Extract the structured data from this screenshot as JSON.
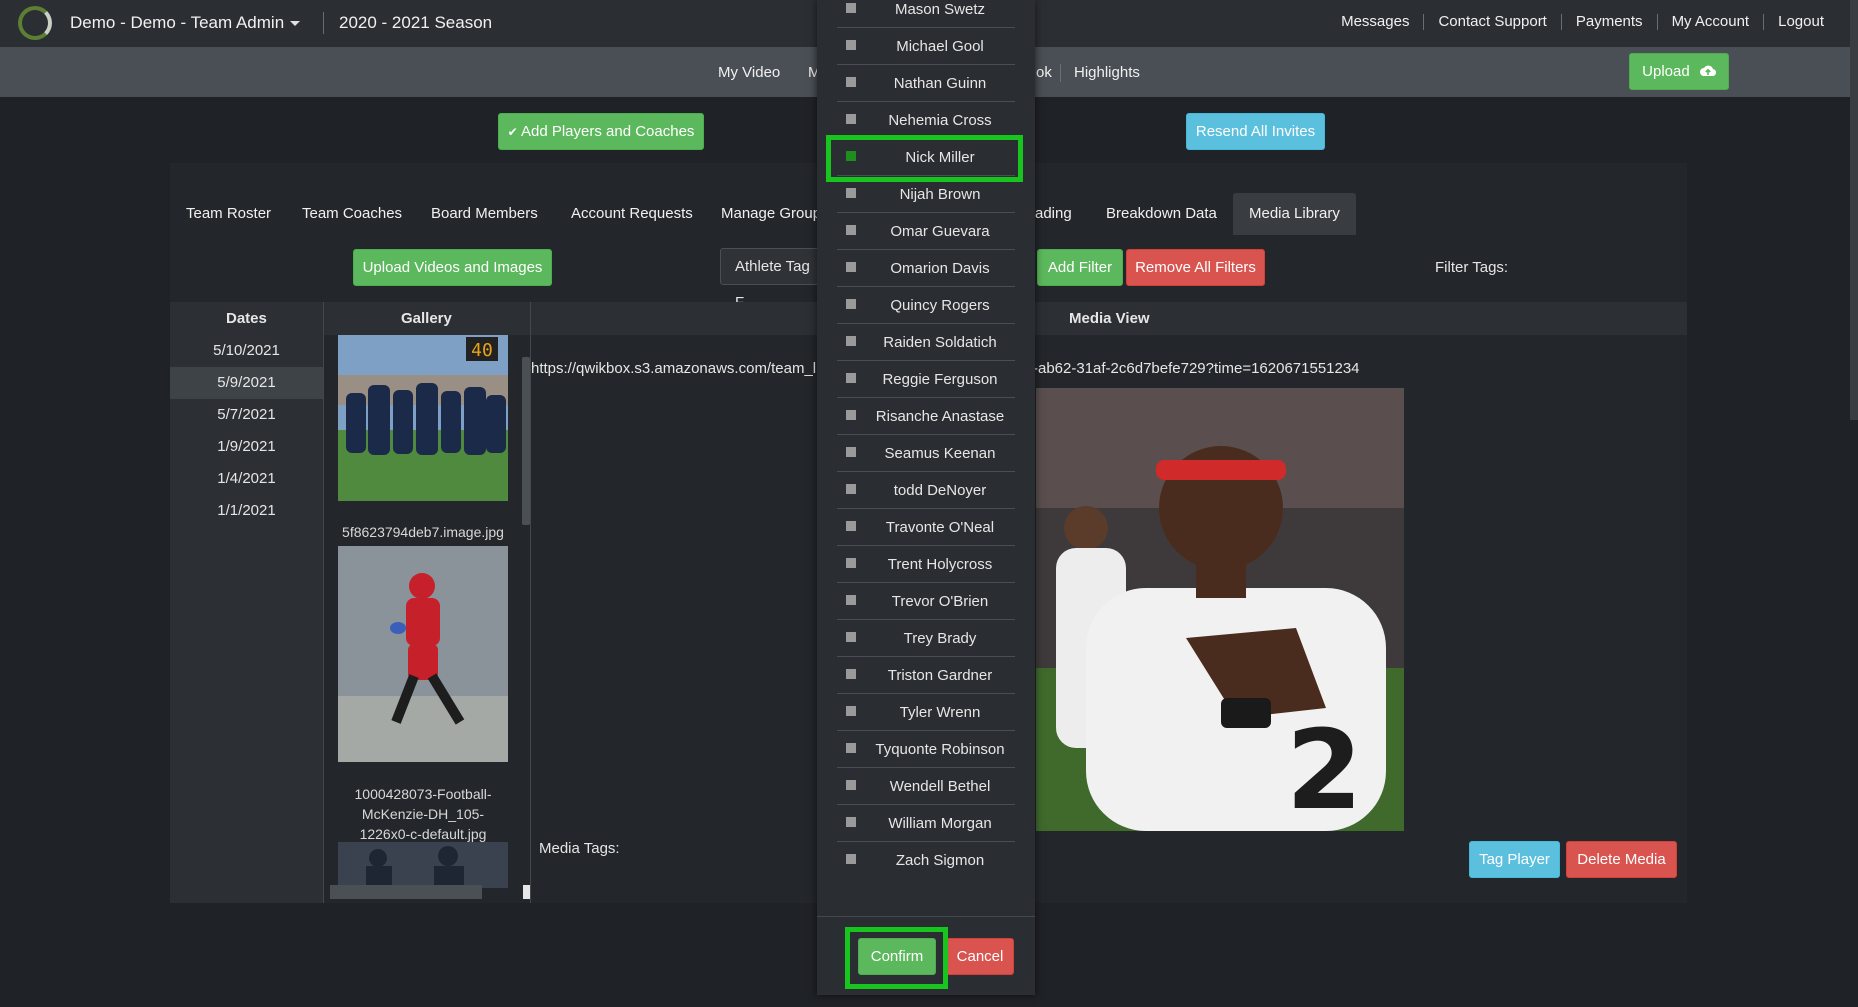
{
  "header": {
    "brand": "Demo - Demo - Team Admin",
    "season": "2020 - 2021 Season",
    "links": [
      "Messages",
      "Contact Support",
      "Payments",
      "My Account",
      "Logout"
    ]
  },
  "subnav": {
    "items": [
      "My Video",
      "M",
      "ok",
      "Highlights"
    ],
    "upload_label": "Upload"
  },
  "actions": {
    "add_players": "Add Players and Coaches",
    "resend": "Resend All Invites"
  },
  "tabs": [
    "Team Roster",
    "Team Coaches",
    "Board Members",
    "Account Requests",
    "Manage Group",
    "ading",
    "Breakdown Data",
    "Media Library"
  ],
  "filters": {
    "upload_label": "Upload Videos and Images",
    "athlete_tag_label": "Athlete Tag F",
    "add_filter": "Add Filter",
    "remove_filters": "Remove All Filters",
    "filter_tags_label": "Filter Tags:"
  },
  "grid": {
    "dates_header": "Dates",
    "gallery_header": "Gallery",
    "media_header": "Media View",
    "dates": [
      "5/10/2021",
      "5/9/2021",
      "5/7/2021",
      "1/9/2021",
      "1/4/2021",
      "1/1/2021"
    ],
    "gallery_captions": [
      "5f8623794deb7.image.jpg",
      "1000428073-Football-",
      "McKenzie-DH_105-",
      "1226x0-c-default.jpg"
    ],
    "url_left": "https://qwikbox.s3.amazonaws.com/team_li",
    "url_right": "-ab62-31af-2c6d7befe729?time=1620671551234",
    "media_tags_label": "Media Tags:",
    "tag_player": "Tag Player",
    "delete_media": "Delete Media",
    "scoreboard": "40"
  },
  "player_modal": {
    "players": [
      "Mason Swetz",
      "Michael Gool",
      "Nathan Guinn",
      "Nehemia Cross",
      "Nick Miller",
      "Nijah Brown",
      "Omar Guevara",
      "Omarion Davis",
      "Quincy Rogers",
      "Raiden Soldatich",
      "Reggie Ferguson",
      "Risanche Anastase",
      "Seamus Keenan",
      "todd DeNoyer",
      "Travonte O'Neal",
      "Trent Holycross",
      "Trevor O'Brien",
      "Trey Brady",
      "Triston Gardner",
      "Tyler Wrenn",
      "Tyquonte Robinson",
      "Wendell Bethel",
      "William Morgan",
      "Zach Sigmon"
    ],
    "selected": "Nick Miller",
    "confirm": "Confirm",
    "cancel": "Cancel"
  },
  "colors": {
    "accent_green": "#5cb85c",
    "info_blue": "#5bc0de",
    "danger_red": "#d9534f",
    "highlight": "#18c41e"
  }
}
